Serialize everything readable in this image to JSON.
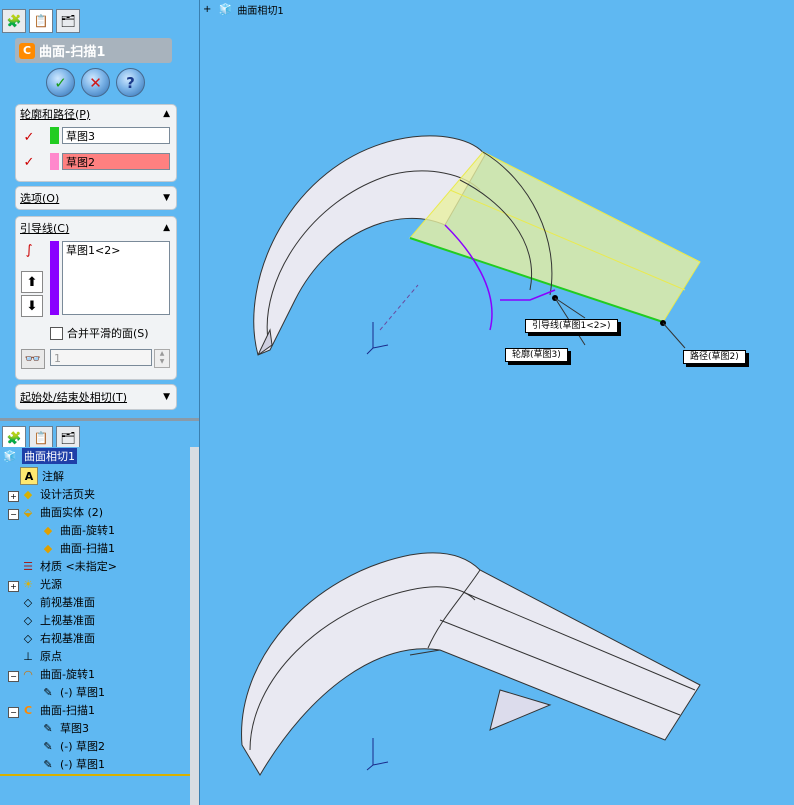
{
  "property_manager": {
    "tabs": [
      "feature-manager",
      "property-manager",
      "configuration-manager"
    ],
    "title": "曲面-扫描1",
    "buttons": {
      "ok": "✓",
      "cancel": "✕",
      "help": "?"
    },
    "profile_path": {
      "header": "轮廓和路径(P)",
      "profile_value": "草图3",
      "path_value": "草图2",
      "profile_color": "#22cc22",
      "path_color": "#ff88aa",
      "path_field_bg": "#ff8080"
    },
    "options": {
      "header": "选项(O)"
    },
    "guides": {
      "header": "引导线(C)",
      "items": [
        "草图1<2>"
      ],
      "merge_label": "合并平滑的面(S)",
      "spin_value": "1",
      "list_color": "#8a00ff"
    },
    "tangency": {
      "header": "起始处/结束处相切(T)"
    }
  },
  "feature_tree": {
    "tabs": [
      "feature-manager",
      "property-manager",
      "configuration-manager"
    ],
    "items": [
      {
        "label": "曲面相切1",
        "icon": "part-icon",
        "level": 0,
        "expander": ""
      },
      {
        "label": "注解",
        "icon": "annotation-icon",
        "level": 1,
        "expander": ""
      },
      {
        "label": "设计活页夹",
        "icon": "design-binder-icon",
        "level": 1,
        "expander": "+"
      },
      {
        "label": "曲面实体 (2)",
        "icon": "surface-bodies-icon",
        "level": 1,
        "expander": "−"
      },
      {
        "label": "曲面-旋转1",
        "icon": "surface-icon",
        "level": 2,
        "expander": ""
      },
      {
        "label": "曲面-扫描1",
        "icon": "surface-icon",
        "level": 2,
        "expander": ""
      },
      {
        "label": "材质 <未指定>",
        "icon": "material-icon",
        "level": 1,
        "expander": ""
      },
      {
        "label": "光源",
        "icon": "lights-icon",
        "level": 1,
        "expander": "+"
      },
      {
        "label": "前视基准面",
        "icon": "plane-icon",
        "level": 1,
        "expander": ""
      },
      {
        "label": "上视基准面",
        "icon": "plane-icon",
        "level": 1,
        "expander": ""
      },
      {
        "label": "右视基准面",
        "icon": "plane-icon",
        "level": 1,
        "expander": ""
      },
      {
        "label": "原点",
        "icon": "origin-icon",
        "level": 1,
        "expander": ""
      },
      {
        "label": "曲面-旋转1",
        "icon": "revolve-icon",
        "level": 1,
        "expander": "−"
      },
      {
        "label": "(-) 草图1",
        "icon": "sketch-icon",
        "level": 2,
        "expander": ""
      },
      {
        "label": "曲面-扫描1",
        "icon": "sweep-icon",
        "level": 1,
        "expander": "−"
      },
      {
        "label": "草图3",
        "icon": "sketch-icon",
        "level": 2,
        "expander": ""
      },
      {
        "label": "(-) 草图2",
        "icon": "sketch-icon",
        "level": 2,
        "expander": ""
      },
      {
        "label": "(-) 草图1",
        "icon": "sketch-icon",
        "level": 2,
        "expander": ""
      }
    ]
  },
  "viewport": {
    "breadcrumb": "曲面相切1",
    "callouts": {
      "guide": "引导线(草图1<2>)",
      "profile": "轮廓(草图3)",
      "path": "路径(草图2)"
    },
    "background": "#5fb8f2"
  }
}
